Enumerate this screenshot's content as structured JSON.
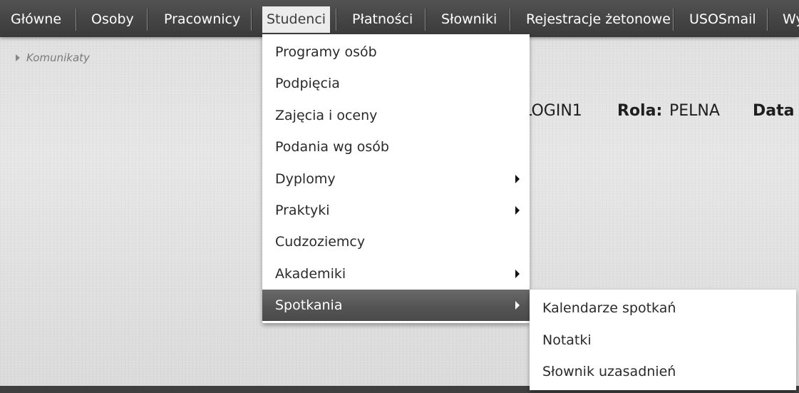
{
  "nav": {
    "items": [
      {
        "label": "Główne"
      },
      {
        "label": "Osoby"
      },
      {
        "label": "Pracownicy"
      },
      {
        "label": "Studenci",
        "active": true
      },
      {
        "label": "Płatności"
      },
      {
        "label": "Słowniki"
      },
      {
        "label": "Rejestracje żetonowe"
      },
      {
        "label": "USOSmail"
      },
      {
        "label": "Wy"
      }
    ]
  },
  "breadcrumb": {
    "komunikaty_label": "Komunikaty"
  },
  "session_info": {
    "login_value": "LOGIN1",
    "role_label": "Rola:",
    "role_value": "PELNA",
    "date_label": "Data w"
  },
  "menu_studenci": {
    "items": [
      {
        "label": "Programy osób"
      },
      {
        "label": "Podpięcia"
      },
      {
        "label": "Zajęcia i oceny"
      },
      {
        "label": "Podania wg osób"
      },
      {
        "label": "Dyplomy",
        "has_submenu": true
      },
      {
        "label": "Praktyki",
        "has_submenu": true
      },
      {
        "label": "Cudzoziemcy"
      },
      {
        "label": "Akademiki",
        "has_submenu": true
      },
      {
        "label": "Spotkania",
        "has_submenu": true,
        "highlighted": true
      }
    ]
  },
  "submenu_spotkania": {
    "items": [
      {
        "label": "Kalendarze spotkań"
      },
      {
        "label": "Notatki"
      },
      {
        "label": "Słownik uzasadnień"
      }
    ]
  },
  "colors": {
    "navbar": "#444444",
    "active_tab_bg": "#ececec",
    "menu_highlight": "#565656",
    "background": "#e3e3e3"
  },
  "icons": {
    "submenu_arrow": "caret-right-icon",
    "komunikaty_toggle": "caret-right-icon"
  }
}
